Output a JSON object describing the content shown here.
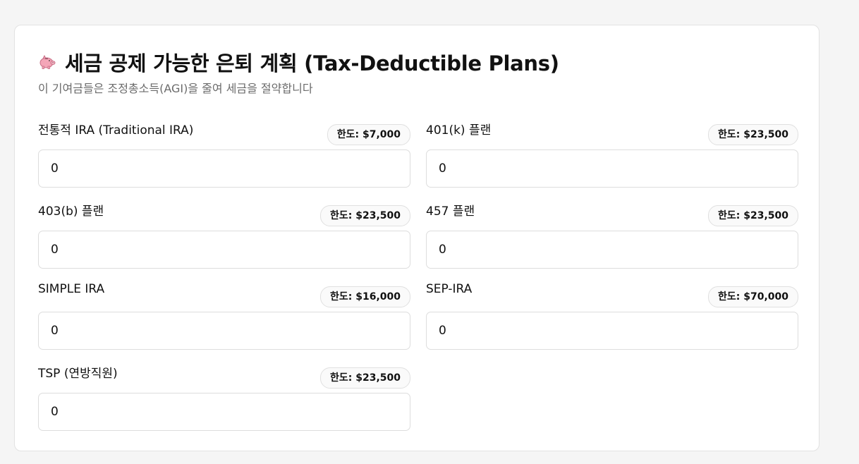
{
  "header": {
    "icon": "piggy-bank-icon",
    "title": "세금 공제 가능한 은퇴 계획 (Tax-Deductible Plans)",
    "subtitle": "이 기여금들은 조정총소득(AGI)을 줄여 세금을 절약합니다"
  },
  "fields": [
    {
      "label": "전통적 IRA (Traditional IRA)",
      "limit": "한도: $7,000",
      "value": "0"
    },
    {
      "label": "401(k) 플랜",
      "limit": "한도: $23,500",
      "value": "0"
    },
    {
      "label": "403(b) 플랜",
      "limit": "한도: $23,500",
      "value": "0"
    },
    {
      "label": "457 플랜",
      "limit": "한도: $23,500",
      "value": "0"
    },
    {
      "label": "SIMPLE IRA",
      "limit": "한도: $16,000",
      "value": "0"
    },
    {
      "label": "SEP-IRA",
      "limit": "한도: $70,000",
      "value": "0"
    },
    {
      "label": "TSP (연방직원)",
      "limit": "한도: $23,500",
      "value": "0"
    }
  ],
  "colors": {
    "icon_pink": "#f4a6b8",
    "border": "#dddddd",
    "subtitle": "#6b6b6b"
  }
}
